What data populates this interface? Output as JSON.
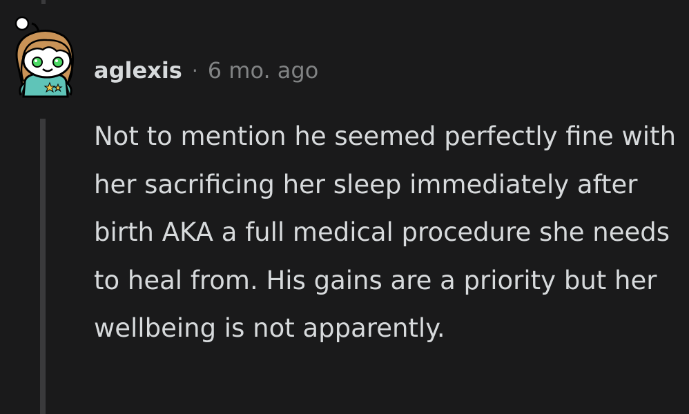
{
  "comment": {
    "author": "aglexis",
    "separator": "·",
    "time_ago": "6 mo. ago",
    "body": "Not to mention he seemed perfectly fine with her sacrificing her sleep immediately after birth AKA a full medical procedure she needs to heal from. His gains are a priority but her wellbeing is not apparently."
  },
  "avatar": {
    "icon": "snoo-avatar-icon",
    "hair_color": "#c99357",
    "eye_color": "#4cd964",
    "shirt_color": "#5fc4b8",
    "star_color": "#f2c94c"
  },
  "colors": {
    "background": "#1a1a1b",
    "text": "#d7dadc",
    "muted": "#818384",
    "thread_line": "#3a3a3c"
  }
}
